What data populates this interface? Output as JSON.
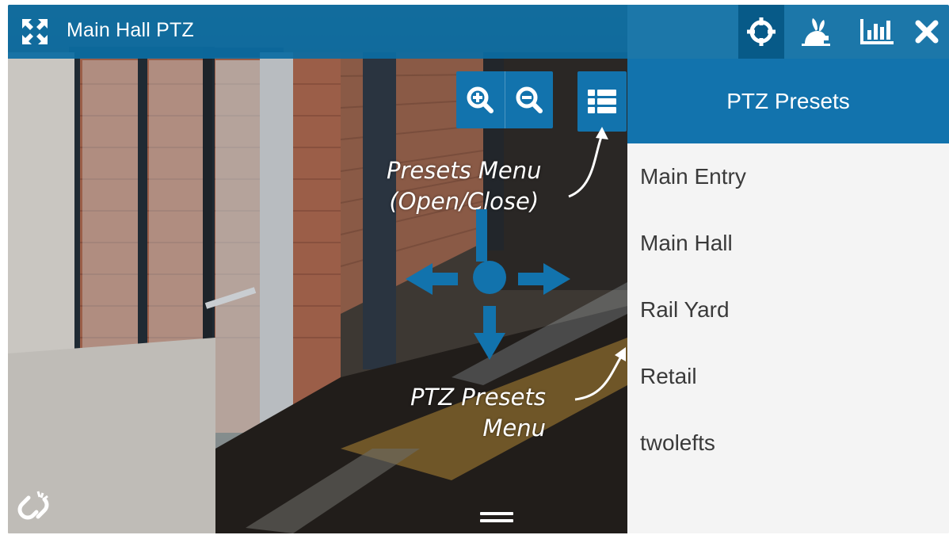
{
  "window": {
    "title": "Main Hall PTZ"
  },
  "toolbar": {
    "icons": [
      "expand-icon",
      "target-icon",
      "rabbit-icon",
      "bar-chart-icon",
      "close-icon"
    ]
  },
  "controls": {
    "zoom_icons": [
      "zoom-in-icon",
      "zoom-out-icon"
    ],
    "presets_toggle_icon": "list-icon",
    "dpad_icons": [
      "arrow-up-icon",
      "arrow-left-icon",
      "center-dot-icon",
      "arrow-right-icon",
      "arrow-down-icon"
    ],
    "link_icon": "broken-link-icon"
  },
  "annotations": {
    "presets_menu_line1": "Presets Menu",
    "presets_menu_line2": "(Open/Close)",
    "ptz_menu_line1": "PTZ  Presets",
    "ptz_menu_line2": "Menu"
  },
  "panel": {
    "title": "PTZ Presets",
    "presets": [
      "Main Entry",
      "Main Hall",
      "Rail Yard",
      "Retail",
      "twolefts"
    ]
  },
  "colors": {
    "accent": "#1273ad",
    "titlebar": "#0b6da3",
    "panel_bg": "#f4f4f4",
    "text": "#3a3a3a"
  }
}
